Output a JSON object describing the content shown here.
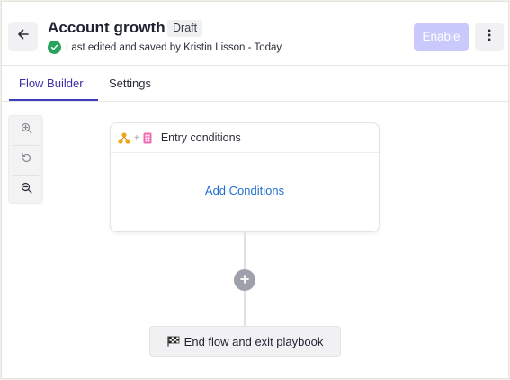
{
  "header": {
    "title": "Account growth",
    "badge": "Draft",
    "status_text": "Last edited and saved by Kristin Lisson - Today",
    "enable_label": "Enable",
    "back_icon": "arrow-left-icon",
    "more_icon": "vertical-dots-icon"
  },
  "tabs": [
    {
      "label": "Flow Builder",
      "active": true
    },
    {
      "label": "Settings",
      "active": false
    }
  ],
  "zoom_toolbar": {
    "items": [
      "zoom-in-icon",
      "reset-icon",
      "zoom-out-icon"
    ]
  },
  "flow": {
    "entry_title": "Entry conditions",
    "entry_plus": "+",
    "add_conditions_label": "Add Conditions",
    "end_label": "End flow and exit playbook"
  },
  "colors": {
    "accent": "#3f3cbb",
    "enable_disabled": "#c9c9fb",
    "link": "#1f6fd1",
    "success": "#27a35a"
  }
}
